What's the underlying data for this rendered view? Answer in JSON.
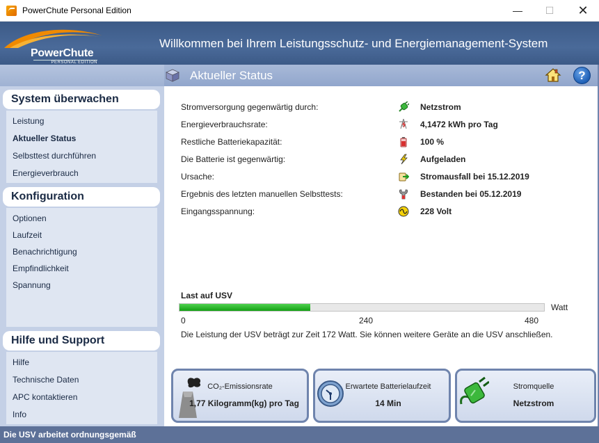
{
  "window": {
    "title": "PowerChute Personal Edition",
    "minimize_glyph": "—",
    "maximize_glyph": "☐",
    "close_glyph": "✕"
  },
  "banner": {
    "logo_name": "PowerChute",
    "logo_sub": "PERSONAL EDITION",
    "title": "Willkommen bei Ihrem Leistungsschutz- und Energiemanagement-System"
  },
  "subheader": {
    "title": "Aktueller Status",
    "home_icon": "home-icon",
    "help_glyph": "?"
  },
  "sidebar": {
    "sections": [
      {
        "title": "System überwachen",
        "items": [
          {
            "label": "Leistung",
            "active": false
          },
          {
            "label": "Aktueller Status",
            "active": true
          },
          {
            "label": "Selbsttest durchführen",
            "active": false
          },
          {
            "label": "Energieverbrauch",
            "active": false
          }
        ]
      },
      {
        "title": "Konfiguration",
        "items": [
          {
            "label": "Optionen",
            "active": false
          },
          {
            "label": "Laufzeit",
            "active": false
          },
          {
            "label": "Benachrichtigung",
            "active": false
          },
          {
            "label": "Empfindlichkeit",
            "active": false
          },
          {
            "label": "Spannung",
            "active": false
          }
        ]
      },
      {
        "title": "Hilfe und Support",
        "items": [
          {
            "label": "Hilfe",
            "active": false
          },
          {
            "label": "Technische Daten",
            "active": false
          },
          {
            "label": "APC kontaktieren",
            "active": false
          },
          {
            "label": "Info",
            "active": false
          }
        ]
      }
    ]
  },
  "status_rows": [
    {
      "label": "Stromversorgung gegenwärtig durch:",
      "value": "Netzstrom",
      "icon": "plug-icon"
    },
    {
      "label": "Energieverbrauchsrate:",
      "value": "4,1472 kWh pro Tag",
      "icon": "power-tower-icon"
    },
    {
      "label": "Restliche Batteriekapazität:",
      "value": "100 %",
      "icon": "battery-icon"
    },
    {
      "label": "Die Batterie ist gegenwärtig:",
      "value": "Aufgeladen",
      "icon": "lightning-icon"
    },
    {
      "label": "Ursache:",
      "value": "Stromausfall bei 15.12.2019",
      "icon": "transfer-icon"
    },
    {
      "label": "Ergebnis des letzten manuellen Selbsttests:",
      "value": "Bestanden bei 05.12.2019",
      "icon": "wrench-icon"
    },
    {
      "label": "Eingangsspannung:",
      "value": "228 Volt",
      "icon": "voltage-icon"
    }
  ],
  "load": {
    "title": "Last auf USV",
    "unit": "Watt",
    "value_watts": 172,
    "max_watts": 480,
    "ticks": [
      "0",
      "240",
      "480"
    ],
    "description": "Die Leistung der USV beträgt zur Zeit 172 Watt. Sie können weitere Geräte an die USV anschließen.",
    "fill_color": "#23b523"
  },
  "cards": [
    {
      "title": "CO₂-Emissionsrate",
      "value": "1,77 Kilogramm(kg) pro Tag",
      "icon": "factory-icon"
    },
    {
      "title": "Erwartete Batterielaufzeit",
      "value": "14 Min",
      "icon": "clock-icon"
    },
    {
      "title": "Stromquelle",
      "value": "Netzstrom",
      "icon": "plug-icon"
    }
  ],
  "statusbar": {
    "text": "Die USV arbeitet ordnungsgemäß"
  },
  "colors": {
    "banner": "#3c5a87",
    "subheader": "#9fb2d3",
    "sidebar": "#c4d0e6",
    "statusbar": "#5d7198"
  }
}
